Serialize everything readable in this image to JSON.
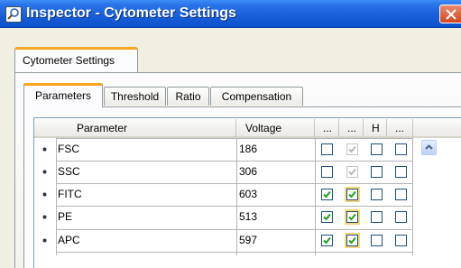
{
  "window": {
    "title": "Inspector - Cytometer Settings",
    "icon": "inspector-icon",
    "close_icon": "close-icon"
  },
  "outer_tabs": [
    {
      "label": "Cytometer Settings",
      "active": true
    }
  ],
  "inner_tabs": [
    {
      "label": "Parameters",
      "active": true
    },
    {
      "label": "Threshold",
      "active": false
    },
    {
      "label": "Ratio",
      "active": false
    },
    {
      "label": "Compensation",
      "active": false
    }
  ],
  "grid": {
    "columns": {
      "parameter": "Parameter",
      "voltage": "Voltage",
      "col3": "...",
      "col4": "...",
      "col5": "H",
      "col6": "..."
    },
    "rows": [
      {
        "parameter": "FSC",
        "voltage": "186",
        "c3": false,
        "c4": true,
        "c4_disabled": true,
        "c5": false,
        "c6": false
      },
      {
        "parameter": "SSC",
        "voltage": "306",
        "c3": false,
        "c4": true,
        "c4_disabled": true,
        "c5": false,
        "c6": false
      },
      {
        "parameter": "FITC",
        "voltage": "603",
        "c3": true,
        "c4": true,
        "c4_disabled": false,
        "c5": false,
        "c6": false
      },
      {
        "parameter": "PE",
        "voltage": "513",
        "c3": true,
        "c4": true,
        "c4_disabled": false,
        "c5": false,
        "c6": false
      },
      {
        "parameter": "APC",
        "voltage": "597",
        "c3": true,
        "c4": true,
        "c4_disabled": false,
        "c5": false,
        "c6": false
      }
    ]
  },
  "colors": {
    "titlebar": "#175ed8",
    "tab_accent": "#f5a623",
    "check": "#21a121",
    "check_disabled": "#b8b8b8"
  }
}
